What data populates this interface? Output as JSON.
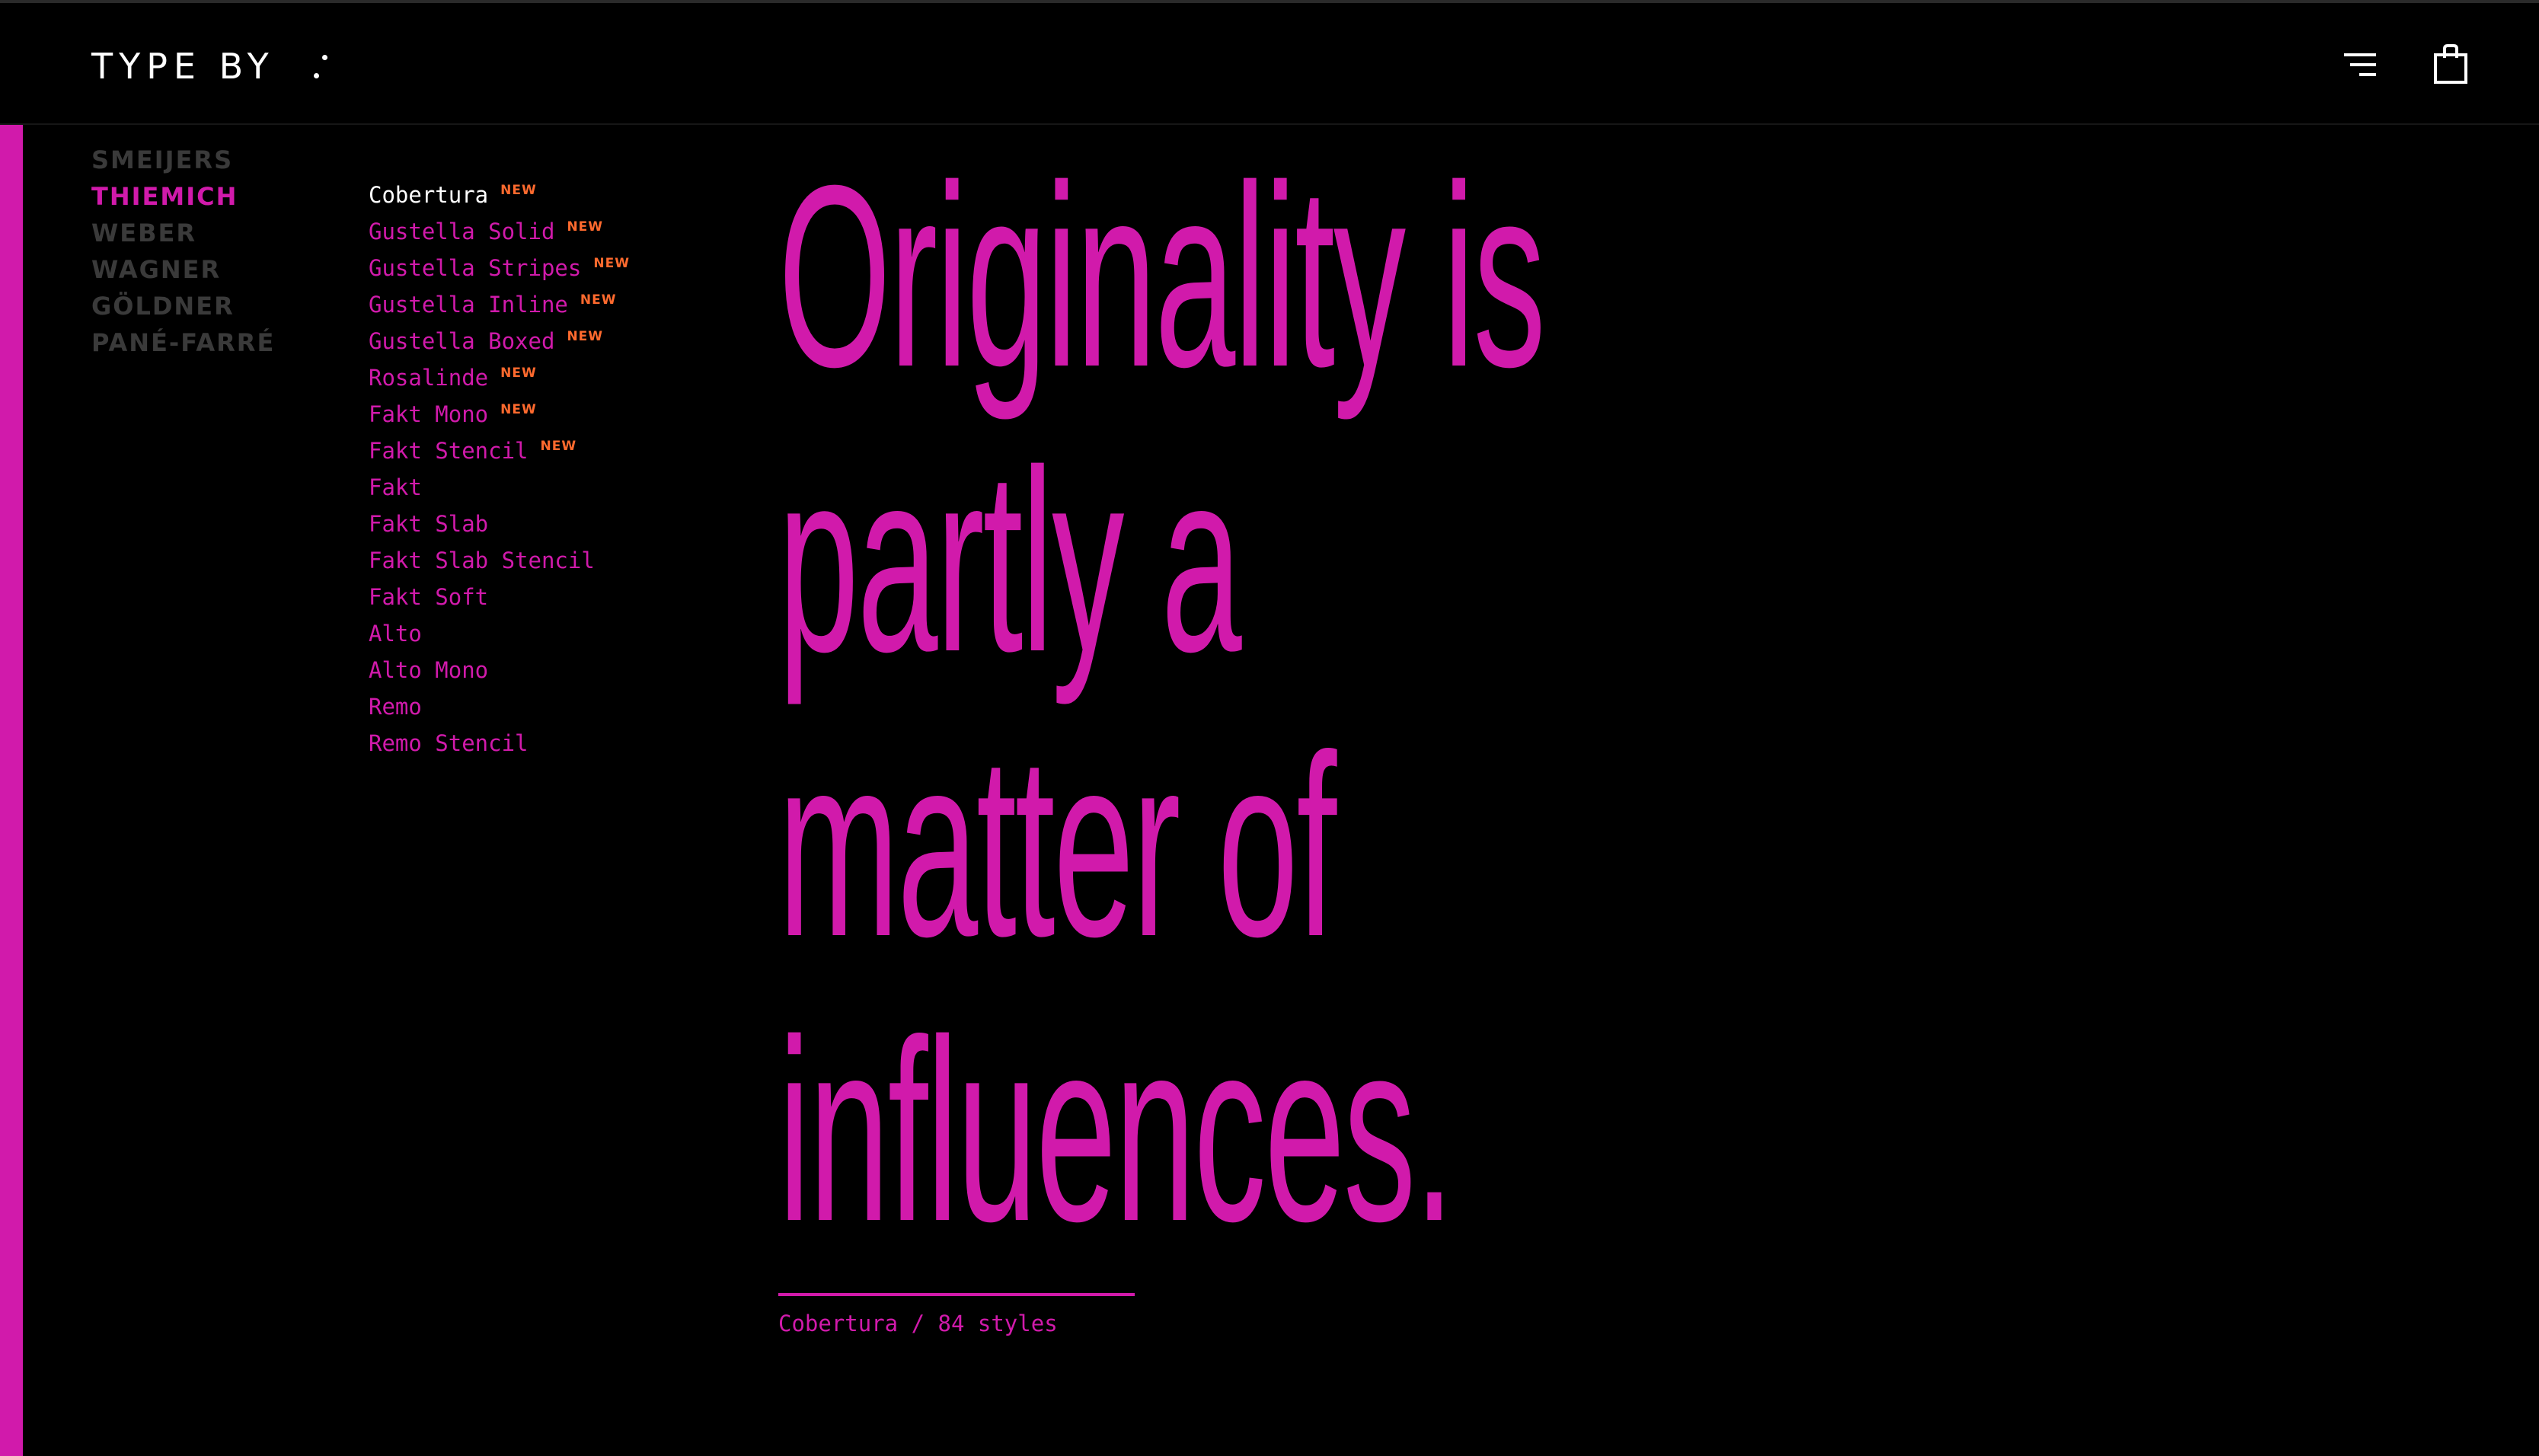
{
  "header": {
    "logo_text": "TYPE BY",
    "menu_icon": "menu-icon",
    "cart_icon": "shopping-bag-icon"
  },
  "designers": [
    {
      "label": "SMEIJERS",
      "active": false
    },
    {
      "label": "THIEMICH",
      "active": true
    },
    {
      "label": "WEBER",
      "active": false
    },
    {
      "label": "WAGNER",
      "active": false
    },
    {
      "label": "GÖLDNER",
      "active": false
    },
    {
      "label": "PANÉ-FARRÉ",
      "active": false
    }
  ],
  "fonts": [
    {
      "label": "Cobertura",
      "badge": "NEW",
      "active": true
    },
    {
      "label": "Gustella Solid",
      "badge": "NEW",
      "active": false
    },
    {
      "label": "Gustella Stripes",
      "badge": "NEW",
      "active": false
    },
    {
      "label": "Gustella Inline",
      "badge": "NEW",
      "active": false
    },
    {
      "label": "Gustella Boxed",
      "badge": "NEW",
      "active": false
    },
    {
      "label": "Rosalinde",
      "badge": "NEW",
      "active": false
    },
    {
      "label": "Fakt Mono",
      "badge": "NEW",
      "active": false
    },
    {
      "label": "Fakt Stencil",
      "badge": "NEW",
      "active": false
    },
    {
      "label": "Fakt",
      "badge": "",
      "active": false
    },
    {
      "label": "Fakt Slab",
      "badge": "",
      "active": false
    },
    {
      "label": "Fakt Slab Stencil",
      "badge": "",
      "active": false
    },
    {
      "label": "Fakt Soft",
      "badge": "",
      "active": false
    },
    {
      "label": "Alto",
      "badge": "",
      "active": false
    },
    {
      "label": "Alto Mono",
      "badge": "",
      "active": false
    },
    {
      "label": "Remo",
      "badge": "",
      "active": false
    },
    {
      "label": "Remo Stencil",
      "badge": "",
      "active": false
    }
  ],
  "hero": {
    "lines": [
      "Originality is",
      "partly a",
      "matter of",
      "influences."
    ]
  },
  "caption": {
    "text": "Cobertura / 84 styles"
  },
  "colors": {
    "accent": "#d11aab",
    "badge": "#ff6a2e",
    "inactive_designer": "#3a3a3a",
    "background": "#000000",
    "text": "#ffffff"
  }
}
